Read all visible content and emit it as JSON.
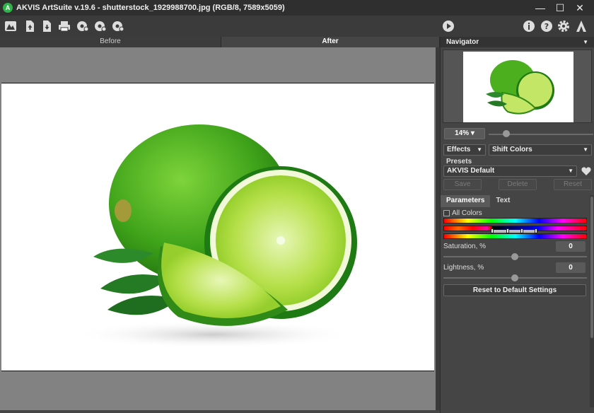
{
  "window": {
    "title": "AKVIS ArtSuite v.19.6 - shutterstock_1929988700.jpg (RGB/8, 7589x5059)",
    "app_icon": "A",
    "minimize": "—",
    "maximize": "☐",
    "close": "✕"
  },
  "toolbar": {
    "left_icons": [
      "home-icon",
      "open-icon",
      "save-icon",
      "print-icon",
      "import-settings-icon",
      "export-settings-icon",
      "plugin-settings-icon"
    ],
    "right_icons": [
      "run-icon",
      "info-icon",
      "help-icon",
      "settings-icon",
      "akvis-logo-icon"
    ]
  },
  "view_tabs": [
    {
      "label": "Before",
      "active": false
    },
    {
      "label": "After",
      "active": true
    }
  ],
  "navigator": {
    "title": "Navigator",
    "zoom": "14%"
  },
  "effects": {
    "category": "Effects",
    "effect": "Shift Colors"
  },
  "presets": {
    "label": "Presets",
    "selected": "AKVIS Default",
    "save": "Save",
    "delete": "Delete",
    "reset": "Reset"
  },
  "param_tabs": [
    {
      "label": "Parameters",
      "active": true
    },
    {
      "label": "Text",
      "active": false
    }
  ],
  "parameters": {
    "all_colors_label": "All Colors",
    "all_colors_checked": false,
    "saturation_label": "Saturation, %",
    "saturation_value": "0",
    "lightness_label": "Lightness, %",
    "lightness_value": "0",
    "reset_button": "Reset to Default Settings"
  },
  "colors": {
    "titlebar": "#2f2f2f",
    "panel": "#454545",
    "canvas_bg": "#828282",
    "lime_green": "#4caf1e"
  }
}
